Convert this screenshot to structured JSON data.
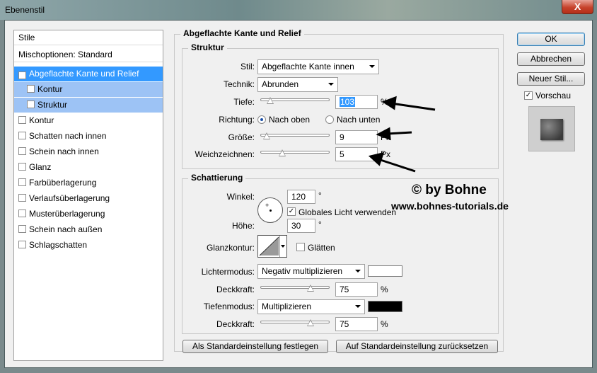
{
  "window": {
    "title": "Ebenenstil",
    "close_label": "X"
  },
  "sidebar": {
    "header": "Stile",
    "blend_options": "Mischoptionen: Standard",
    "items": [
      {
        "label": "Abgeflachte Kante und Relief",
        "checked": true,
        "state": "selected"
      },
      {
        "label": "Kontur",
        "checked": false,
        "state": "sub"
      },
      {
        "label": "Struktur",
        "checked": false,
        "state": "sub"
      },
      {
        "label": "Kontur",
        "checked": false
      },
      {
        "label": "Schatten nach innen",
        "checked": false
      },
      {
        "label": "Schein nach innen",
        "checked": false
      },
      {
        "label": "Glanz",
        "checked": false
      },
      {
        "label": "Farbüberlagerung",
        "checked": false
      },
      {
        "label": "Verlaufsüberlagerung",
        "checked": false
      },
      {
        "label": "Musterüberlagerung",
        "checked": false
      },
      {
        "label": "Schein nach außen",
        "checked": false
      },
      {
        "label": "Schlagschatten",
        "checked": false
      }
    ]
  },
  "panel": {
    "title": "Abgeflachte Kante und Relief",
    "structure": {
      "heading": "Struktur",
      "style_label": "Stil:",
      "style_value": "Abgeflachte Kante innen",
      "technique_label": "Technik:",
      "technique_value": "Abrunden",
      "depth_label": "Tiefe:",
      "depth_value": "103",
      "depth_unit": "%",
      "depth_level": 0.1,
      "direction_label": "Richtung:",
      "direction_up": "Nach oben",
      "direction_down": "Nach unten",
      "size_label": "Größe:",
      "size_value": "9",
      "size_unit": "Px",
      "size_level": 0.05,
      "soften_label": "Weichzeichnen:",
      "soften_value": "5",
      "soften_unit": "Px",
      "soften_level": 0.3
    },
    "shading": {
      "heading": "Schattierung",
      "angle_label": "Winkel:",
      "angle_value": "120",
      "angle_unit": "°",
      "global_light_label": "Globales Licht verwenden",
      "altitude_label": "Höhe:",
      "altitude_value": "30",
      "altitude_unit": "°",
      "gloss_contour_label": "Glanzkontur:",
      "anti_aliased_label": "Glätten",
      "highlight_mode_label": "Lichtermodus:",
      "highlight_mode_value": "Negativ multiplizieren",
      "highlight_color": "#ffffff",
      "highlight_opacity_label": "Deckkraft:",
      "highlight_opacity_value": "75",
      "highlight_opacity_unit": "%",
      "shadow_mode_label": "Tiefenmodus:",
      "shadow_mode_value": "Multiplizieren",
      "shadow_color": "#000000",
      "shadow_opacity_label": "Deckkraft:",
      "shadow_opacity_value": "75",
      "shadow_opacity_unit": "%",
      "opacity_level": 0.75
    },
    "buttons": {
      "make_default": "Als Standardeinstellung festlegen",
      "reset_default": "Auf Standardeinstellung zurücksetzen"
    }
  },
  "actions": {
    "ok": "OK",
    "cancel": "Abbrechen",
    "new_style": "Neuer Stil...",
    "preview": "Vorschau"
  },
  "watermark": {
    "line1": "© by Bohne",
    "line2": "www.bohnes-tutorials.de"
  }
}
